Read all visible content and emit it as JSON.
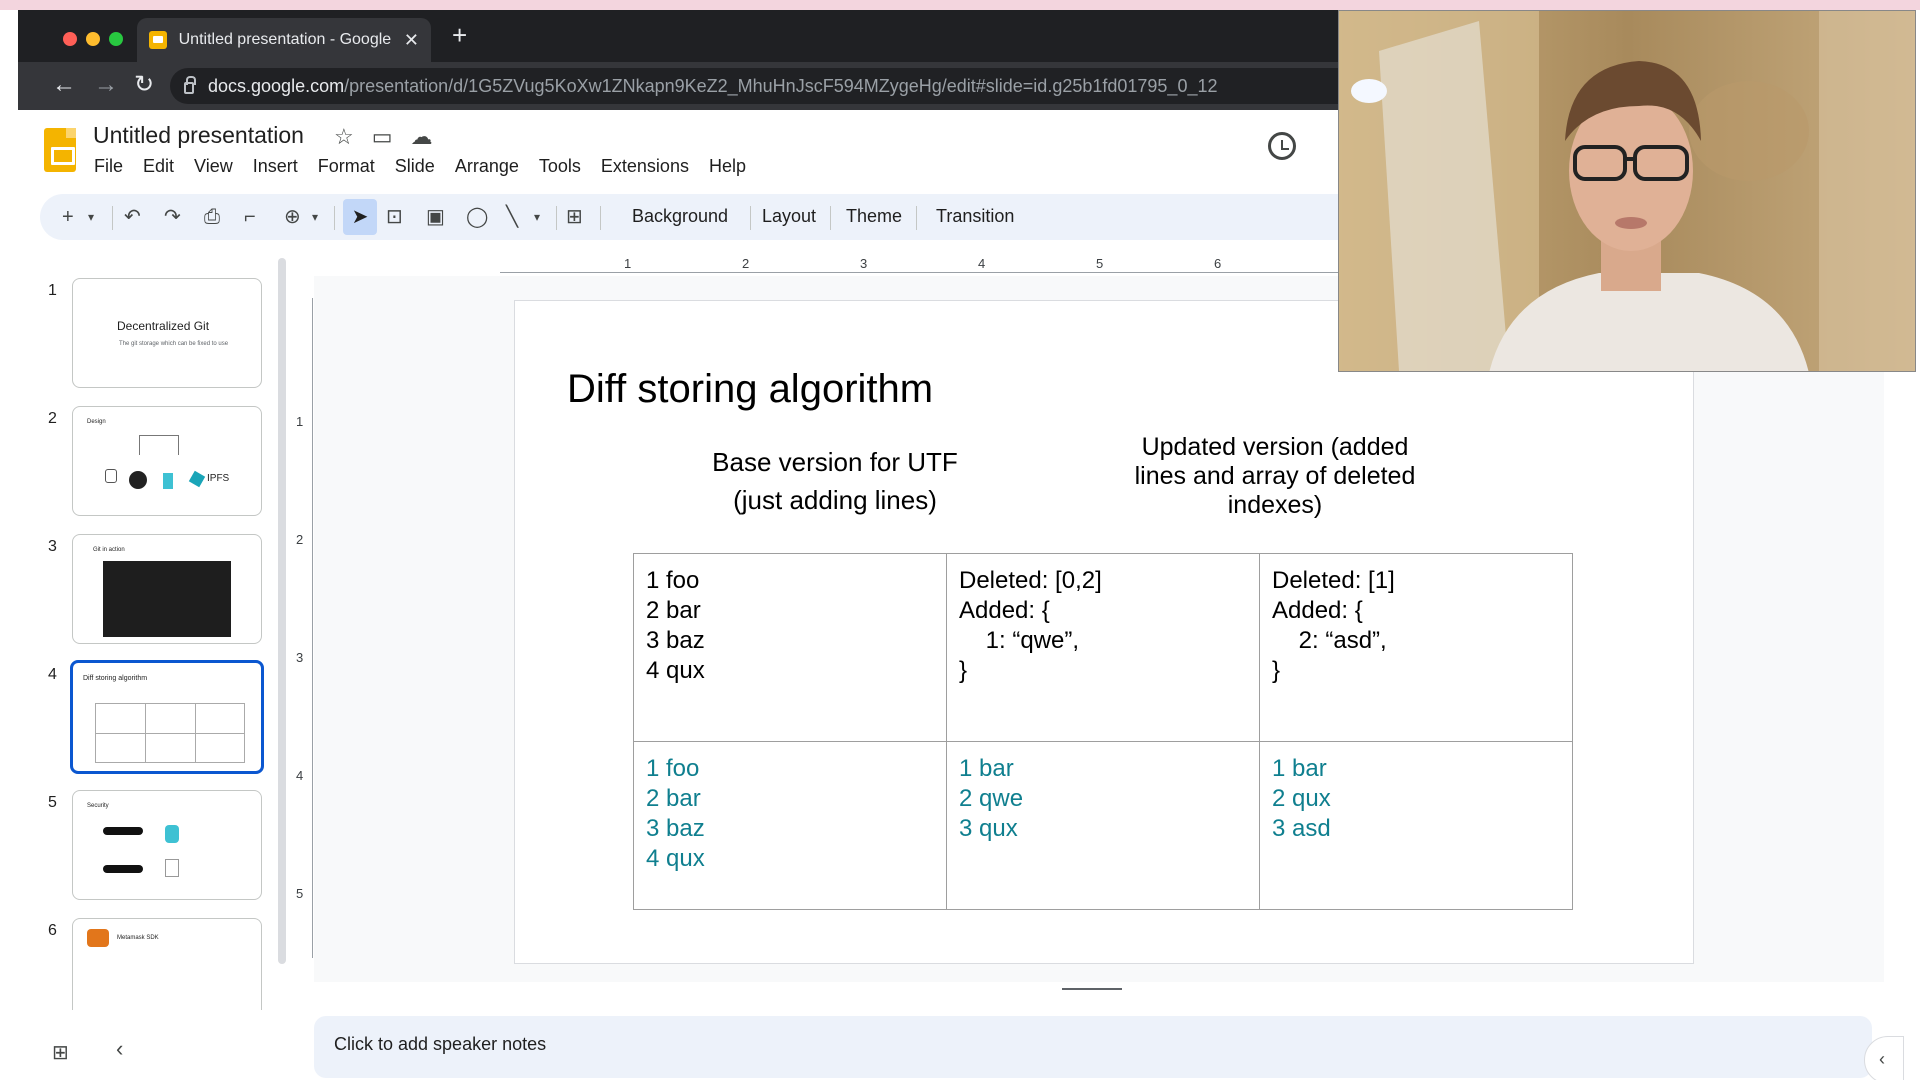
{
  "browser": {
    "tab_title": "Untitled presentation - Google Slides",
    "new_tab": "+",
    "url_host": "docs.google.com",
    "url_path": "/presentation/d/1G5ZVug5KoXw1ZNkapn9KeZ2_MhuHnJscF594MZygeHg/edit#slide=id.g25b1fd01795_0_12"
  },
  "app": {
    "doc_title": "Untitled presentation",
    "menu": [
      "File",
      "Edit",
      "View",
      "Insert",
      "Format",
      "Slide",
      "Arrange",
      "Tools",
      "Extensions",
      "Help"
    ]
  },
  "toolbar": {
    "background": "Background",
    "layout": "Layout",
    "theme": "Theme",
    "transition": "Transition"
  },
  "filmstrip": {
    "slides": [
      {
        "number": "1",
        "title": "Decentralized Git",
        "subtitle": "The git storage which can be fixed to use"
      },
      {
        "number": "2",
        "title": "Design",
        "label": "IPFS"
      },
      {
        "number": "3",
        "title": "Git in action"
      },
      {
        "number": "4",
        "title": "Diff storing algorithm"
      },
      {
        "number": "5",
        "title": "Security"
      },
      {
        "number": "6",
        "title": "Metamask SDK"
      }
    ]
  },
  "rulers": {
    "top": [
      "1",
      "2",
      "3",
      "4",
      "5",
      "6"
    ],
    "left": [
      "1",
      "2",
      "3",
      "4",
      "5"
    ]
  },
  "slide": {
    "title": "Diff storing algorithm",
    "subtitle_left": [
      "Base version for UTF",
      "(just adding lines)"
    ],
    "subtitle_right": [
      "Updated version (added",
      "lines and array of deleted",
      "indexes)"
    ],
    "table": {
      "row1": [
        [
          "1 foo",
          "2 bar",
          "3 baz",
          "4 qux"
        ],
        [
          "Deleted: [0,2]",
          "Added: {",
          "    1: “qwe”,",
          "}"
        ],
        [
          "Deleted: [1]",
          "Added: {",
          "    2: “asd”,",
          "}"
        ]
      ],
      "row2": [
        [
          "1 foo",
          "2 bar",
          "3 baz",
          "4 qux"
        ],
        [
          "1 bar",
          "2 qwe",
          "3 qux"
        ],
        [
          "1 bar",
          "2 qux",
          "3 asd"
        ]
      ]
    }
  },
  "notes": {
    "placeholder": "Click to add speaker notes"
  },
  "colors": {
    "accent": "#0b57d0",
    "table_result_text": "#0f7f8f",
    "slides_brand": "#f4b400"
  }
}
